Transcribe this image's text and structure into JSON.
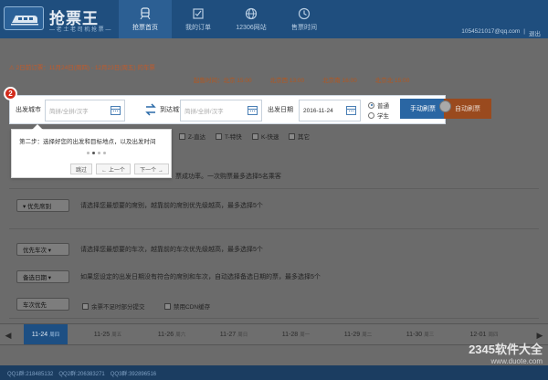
{
  "app": {
    "title": "抢票王",
    "slogan": "— 老 土 老 司 机 抢 票 —"
  },
  "nav": [
    {
      "label": "抢票首页",
      "icon": "train-icon"
    },
    {
      "label": "我的订单",
      "icon": "checklist-icon"
    },
    {
      "label": "12306网站",
      "icon": "globe-icon"
    },
    {
      "label": "售票时间",
      "icon": "clock-icon"
    }
  ],
  "account": {
    "user": "1054521017@qq.com",
    "separator": "|",
    "logout": "退出"
  },
  "notice": {
    "line1": "⚠ 2日前订票：11月24日(周四) - 12月23日(周五) 的车票",
    "line2": [
      "起售时间：北京 15:00",
      "北京西 13:00",
      "北京南 16:00",
      "北京北 15:00"
    ]
  },
  "search": {
    "from_label": "出发城市",
    "from_placeholder": "简拼/全拼/汉字",
    "to_label": "到达城市",
    "to_placeholder": "简拼/全拼/汉字",
    "date_label": "出发日期",
    "date_value": "2016-11-24",
    "type_normal": "普通",
    "type_student": "学生",
    "manual_button": "手动刷票",
    "auto_button": "自动刷票",
    "step_number": "2"
  },
  "tooltip": {
    "text": "第二步：选择好您的出发和目标地点，以及出发时间",
    "prev": "跳过",
    "back": "← 上一个",
    "next": "下一个 →"
  },
  "train_types": [
    "Z-直达",
    "T-特快",
    "K-快速",
    "其它"
  ],
  "hint_passengers": "票成功率。一次购票最多选择5名乘客",
  "priority": {
    "seat_button": "▾ 优先席别",
    "seat_hint": "请选择您最想要的席别，越靠前的席别优先级越高，最多选择5个",
    "train_button": "优先车次 ▾",
    "train_hint": "请选择您最想要的车次，越靠前的车次优先级越高，最多选择5个",
    "date_button": "备选日期 ▾",
    "date_hint": "如果您设定的出发日期没有符合的席别和车次，自动选择备选日期的票，最多选择5个",
    "order_select": "车次优先",
    "opt_no_partial": "余票不足时部分提交",
    "opt_no_cdn": "禁用CDN缓存"
  },
  "dates": [
    {
      "date": "11-24",
      "weekday": "周四",
      "active": true
    },
    {
      "date": "11-25",
      "weekday": "周五"
    },
    {
      "date": "11-26",
      "weekday": "周六"
    },
    {
      "date": "11-27",
      "weekday": "周日"
    },
    {
      "date": "11-28",
      "weekday": "周一"
    },
    {
      "date": "11-29",
      "weekday": "周二"
    },
    {
      "date": "11-30",
      "weekday": "周三"
    },
    {
      "date": "12-01",
      "weekday": "周四"
    }
  ],
  "footer": {
    "qq1": "QQ1群:218485132",
    "qq2": "QQ2群:206383271",
    "qq3": "QQ3群:392896516"
  },
  "watermark": {
    "line1": "2345软件大全",
    "line2": "www.duote.com"
  },
  "colors": {
    "header": "#1f4e7e",
    "active_tab": "#1d4f83",
    "auto_button": "#9a4a1e",
    "step_badge": "#d32c1c"
  }
}
